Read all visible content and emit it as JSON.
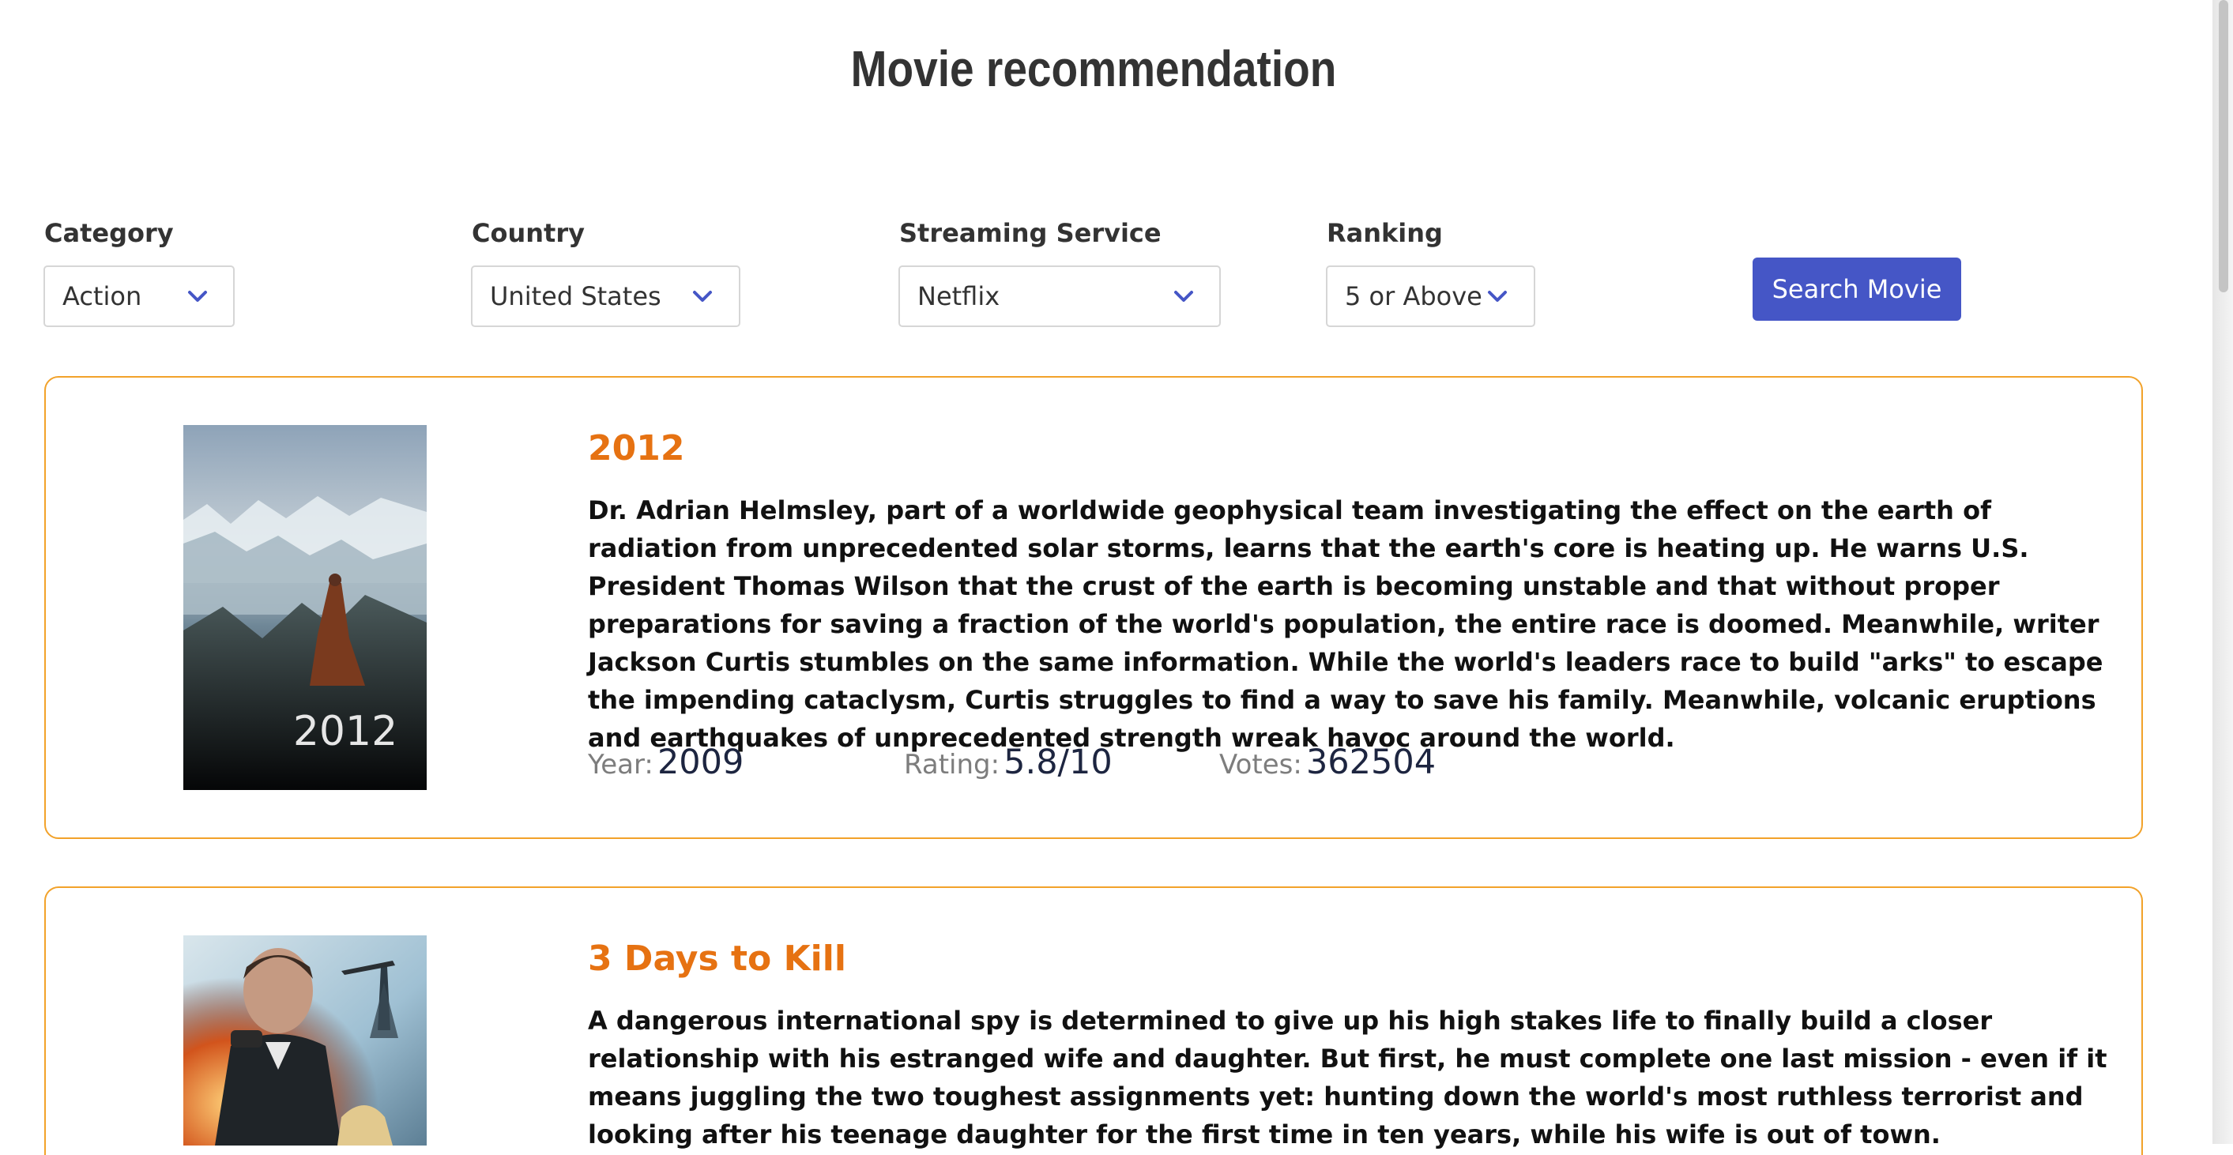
{
  "page_title": "Movie recommendation",
  "filters": {
    "category": {
      "label": "Category",
      "value": "Action"
    },
    "country": {
      "label": "Country",
      "value": "United States"
    },
    "streaming": {
      "label": "Streaming Service",
      "value": "Netflix"
    },
    "ranking": {
      "label": "Ranking",
      "value": "5 or Above"
    }
  },
  "search_button": "Search Movie",
  "movies": [
    {
      "title": "2012",
      "poster_text": "2012",
      "synopsis": "Dr. Adrian Helmsley, part of a worldwide geophysical team investigating the effect on the earth of radiation from unprecedented solar storms, learns that the earth's core is heating up. He warns U.S. President Thomas Wilson that the crust of the earth is becoming unstable and that without proper preparations for saving a fraction of the world's population, the entire race is doomed. Meanwhile, writer Jackson Curtis stumbles on the same information. While the world's leaders race to build \"arks\" to escape the impending cataclysm, Curtis struggles to find a way to save his family. Meanwhile, volcanic eruptions and earthquakes of unprecedented strength wreak havoc around the world.",
      "year_label": "Year:",
      "year": "2009",
      "rating_label": "Rating:",
      "rating": "5.8/10",
      "votes_label": "Votes:",
      "votes": "362504"
    },
    {
      "title": "3 Days to Kill",
      "synopsis": "A dangerous international spy is determined to give up his high stakes life to finally build a closer relationship with his estranged wife and daughter. But first, he must complete one last mission - even if it means juggling the two toughest assignments yet: hunting down the world's most ruthless terrorist and looking after his teenage daughter for the first time in ten years, while his wife is out of town."
    }
  ],
  "colors": {
    "accent_orange": "#e67212",
    "card_border": "#f2a22a",
    "button_blue": "#4556c6"
  }
}
